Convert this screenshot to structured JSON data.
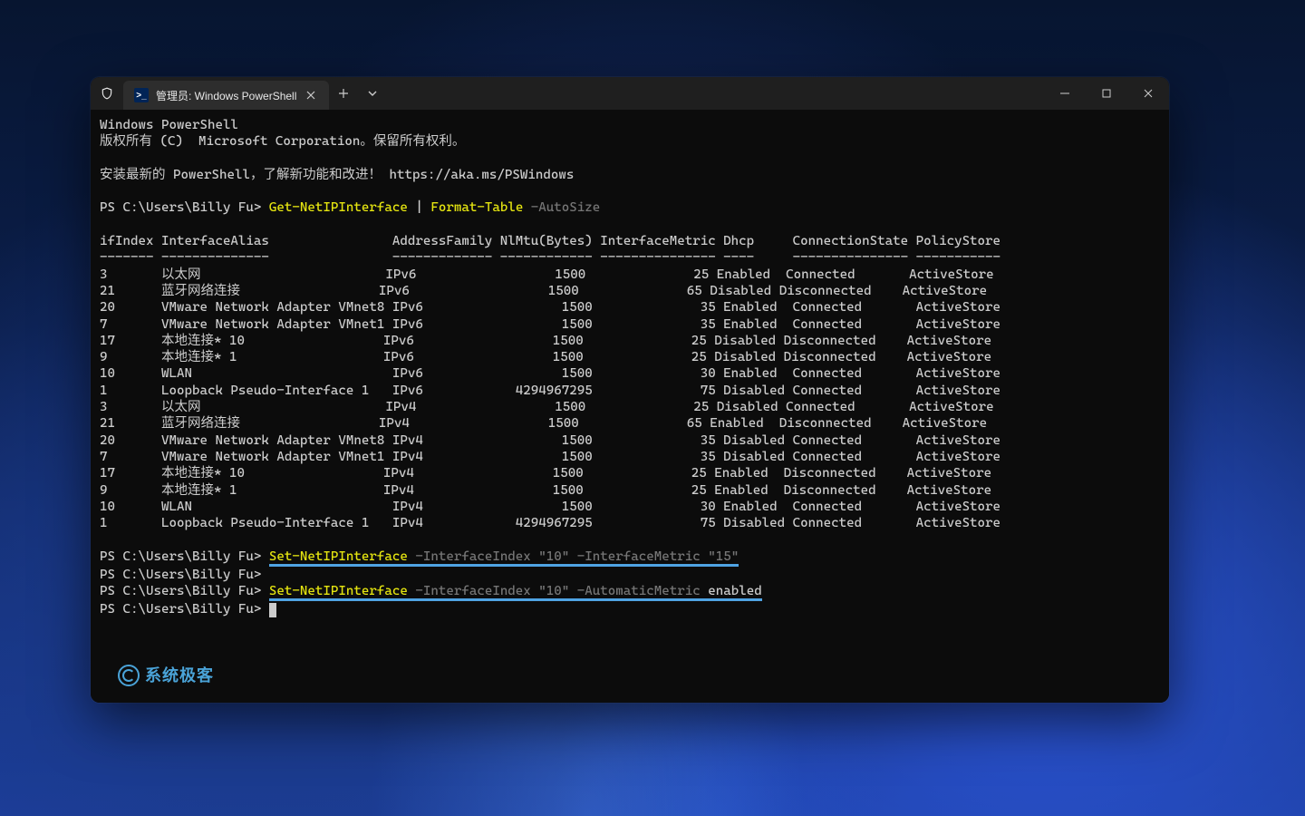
{
  "window": {
    "tab_title": "管理员: Windows PowerShell",
    "ps_icon_text": ">_"
  },
  "banner": {
    "line1": "Windows PowerShell",
    "line2": "版权所有 (C)  Microsoft Corporation。保留所有权利。",
    "line3": "安装最新的 PowerShell，了解新功能和改进！ https://aka.ms/PSWindows"
  },
  "prompt": "PS C:\\Users\\Billy Fu> ",
  "cmd1": {
    "a": "Get-NetIPInterface",
    "pipe": " | ",
    "b": "Format-Table",
    "c": " -AutoSize"
  },
  "table": {
    "header": "ifIndex InterfaceAlias                AddressFamily NlMtu(Bytes) InterfaceMetric Dhcp     ConnectionState PolicyStore",
    "divider": "------- --------------                ------------- ------------ --------------- ----     --------------- -----------",
    "rows": [
      "3       以太网                        IPv6                  1500              25 Enabled  Connected       ActiveStore",
      "21      蓝牙网络连接                  IPv6                  1500              65 Disabled Disconnected    ActiveStore",
      "20      VMware Network Adapter VMnet8 IPv6                  1500              35 Enabled  Connected       ActiveStore",
      "7       VMware Network Adapter VMnet1 IPv6                  1500              35 Enabled  Connected       ActiveStore",
      "17      本地连接* 10                  IPv6                  1500              25 Disabled Disconnected    ActiveStore",
      "9       本地连接* 1                   IPv6                  1500              25 Disabled Disconnected    ActiveStore",
      "10      WLAN                          IPv6                  1500              30 Enabled  Connected       ActiveStore",
      "1       Loopback Pseudo-Interface 1   IPv6            4294967295              75 Disabled Connected       ActiveStore",
      "3       以太网                        IPv4                  1500              25 Disabled Connected       ActiveStore",
      "21      蓝牙网络连接                  IPv4                  1500              65 Enabled  Disconnected    ActiveStore",
      "20      VMware Network Adapter VMnet8 IPv4                  1500              35 Disabled Connected       ActiveStore",
      "7       VMware Network Adapter VMnet1 IPv4                  1500              35 Disabled Connected       ActiveStore",
      "17      本地连接* 10                  IPv4                  1500              25 Enabled  Disconnected    ActiveStore",
      "9       本地连接* 1                   IPv4                  1500              25 Enabled  Disconnected    ActiveStore",
      "10      WLAN                          IPv4                  1500              30 Enabled  Connected       ActiveStore",
      "1       Loopback Pseudo-Interface 1   IPv4            4294967295              75 Disabled Connected       ActiveStore"
    ]
  },
  "cmd2": {
    "a": "Set-NetIPInterface",
    "b": " -InterfaceIndex ",
    "c": "\"10\"",
    "d": " -InterfaceMetric ",
    "e": "\"15\""
  },
  "cmd3": {
    "a": "Set-NetIPInterface",
    "b": " -InterfaceIndex ",
    "c": "\"10\"",
    "d": " -AutomaticMetric ",
    "e": "enabled"
  },
  "watermark": "系统极客"
}
